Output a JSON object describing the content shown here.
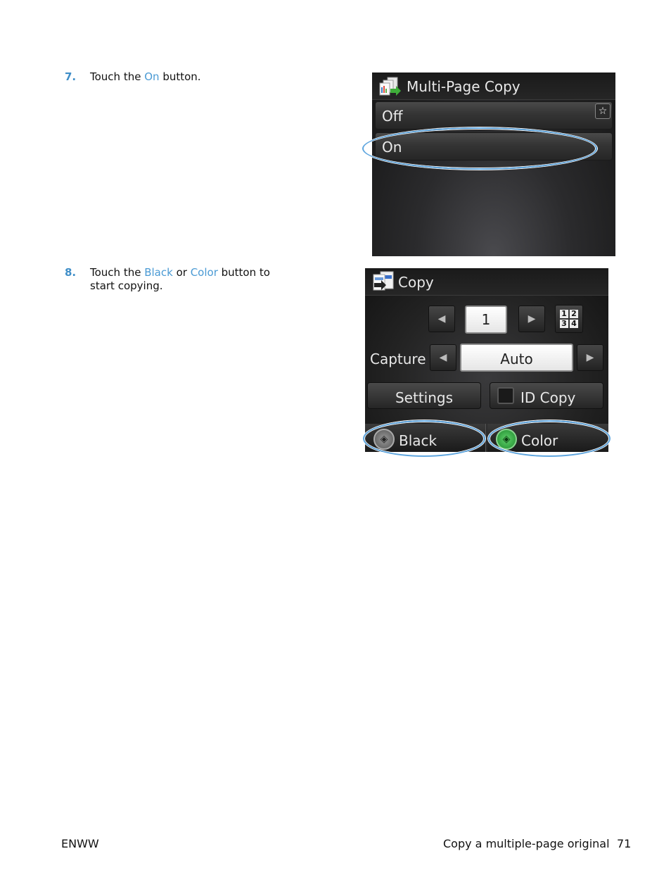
{
  "steps": [
    {
      "number": "7.",
      "parts": [
        {
          "text": "Touch the ",
          "highlight": false
        },
        {
          "text": "On",
          "highlight": true
        },
        {
          "text": " button.",
          "highlight": false
        }
      ]
    },
    {
      "number": "8.",
      "parts": [
        {
          "text": "Touch the ",
          "highlight": false
        },
        {
          "text": "Black",
          "highlight": true
        },
        {
          "text": " or ",
          "highlight": false
        },
        {
          "text": "Color",
          "highlight": true
        },
        {
          "text": " button to start copying.",
          "highlight": false
        }
      ]
    }
  ],
  "screen1": {
    "title": "Multi-Page Copy",
    "title_icon": "multi-page-copy-icon",
    "options": [
      "Off",
      "On"
    ],
    "favorite_icon": "☆",
    "highlighted_option": "On"
  },
  "screen2": {
    "title": "Copy",
    "title_icon": "copy-icon",
    "copies_value": "1",
    "prev_glyph": "◀",
    "next_glyph": "▶",
    "layout_icon_digits": [
      "1",
      "2",
      "3",
      "4"
    ],
    "capture_label": "Capture",
    "capture_value": "Auto",
    "settings_label": "Settings",
    "id_copy_label": "ID Copy",
    "black_label": "Black",
    "color_label": "Color",
    "start_glyph": "◈"
  },
  "footer": {
    "left": "ENWW",
    "section": "Copy a multiple-page original",
    "page_number": "71"
  },
  "colors": {
    "accent_blue": "#4a9ad4",
    "highlight_ring": "#5fa6df",
    "start_green": "#2fa84a"
  }
}
